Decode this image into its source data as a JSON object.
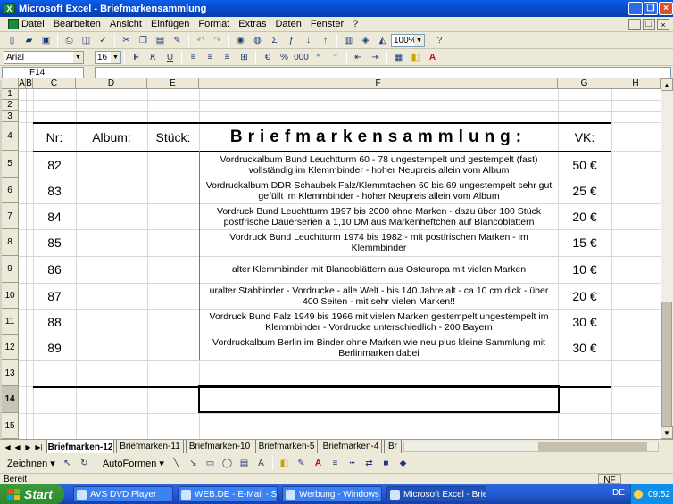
{
  "window": {
    "title": "Microsoft Excel - Briefmarkensammlung"
  },
  "menu": [
    "Datei",
    "Bearbeiten",
    "Ansicht",
    "Einfügen",
    "Format",
    "Extras",
    "Daten",
    "Fenster",
    "?"
  ],
  "toolbar": {
    "zoom": "100%",
    "font": "Arial",
    "size": "16"
  },
  "namebox": "F14",
  "columns": [
    "A",
    "B",
    "C",
    "D",
    "E",
    "F",
    "G",
    "H"
  ],
  "rows": [
    "1",
    "2",
    "3",
    "4",
    "5",
    "6",
    "7",
    "8",
    "9",
    "10",
    "11",
    "12",
    "13",
    "14",
    "15"
  ],
  "header": {
    "nr": "Nr:",
    "album": "Album:",
    "stueck": "Stück:",
    "title": "Briefmarkensammlung:",
    "vk": "VK:"
  },
  "items": [
    {
      "nr": "82",
      "desc": "Vordruckalbum Bund Leuchtturm 60 - 78 ungestempelt und gestempelt (fast) vollständig im Klemmbinder - hoher Neupreis allein vom Album",
      "vk": "50 €"
    },
    {
      "nr": "83",
      "desc": "Vordruckalbum DDR Schaubek Falz/Klemmtachen 60 bis 69 ungestempelt sehr gut gefüllt im Klemmbinder - hoher Neupreis allein vom Album",
      "vk": "25 €"
    },
    {
      "nr": "84",
      "desc": "Vordruck Bund Leuchtturm 1997 bis 2000 ohne Marken - dazu über 100 Stück postfrische Dauerserien a 1,10 DM aus Markenheftchen auf Blancoblättern",
      "vk": "20 €"
    },
    {
      "nr": "85",
      "desc": "Vordruck Bund Leuchtturm 1974 bis 1982 - mit postfrischen Marken - im Klemmbinder",
      "vk": "15 €"
    },
    {
      "nr": "86",
      "desc": "alter Klemmbinder mit Blancoblättern aus Osteuropa mit vielen Marken",
      "vk": "10 €"
    },
    {
      "nr": "87",
      "desc": "uralter Stabbinder - Vordrucke - alle Welt - bis 140 Jahre alt - ca 10 cm dick - über 400 Seiten - mit sehr vielen Marken!!",
      "vk": "20 €"
    },
    {
      "nr": "88",
      "desc": "Vordruck Bund Falz 1949 bis 1966 mit vielen Marken gestempelt ungestempelt im Klemmbinder - Vordrucke unterschiedlich - 200   Bayern",
      "vk": "30 €"
    },
    {
      "nr": "89",
      "desc": "Vordruckalbum Berlin im Binder ohne Marken wie neu plus kleine Sammlung mit Berlinmarken dabei",
      "vk": "30 €"
    }
  ],
  "tabs": [
    "Briefmarken-12",
    "Briefmarken-11",
    "Briefmarken-10",
    "Briefmarken-5",
    "Briefmarken-4",
    "Br"
  ],
  "drawing": {
    "zeichnen": "Zeichnen ▾",
    "autoformen": "AutoFormen ▾"
  },
  "status": {
    "text": "Bereit",
    "nf": "NF"
  },
  "taskbar": {
    "start": "Start",
    "tasks": [
      "AVS DVD Player",
      "WEB.DE - E-Mail - Suc...",
      "Werbung - Windows I...",
      "Microsoft Excel - Brief..."
    ],
    "lang": "DE",
    "clock": "09:52"
  }
}
